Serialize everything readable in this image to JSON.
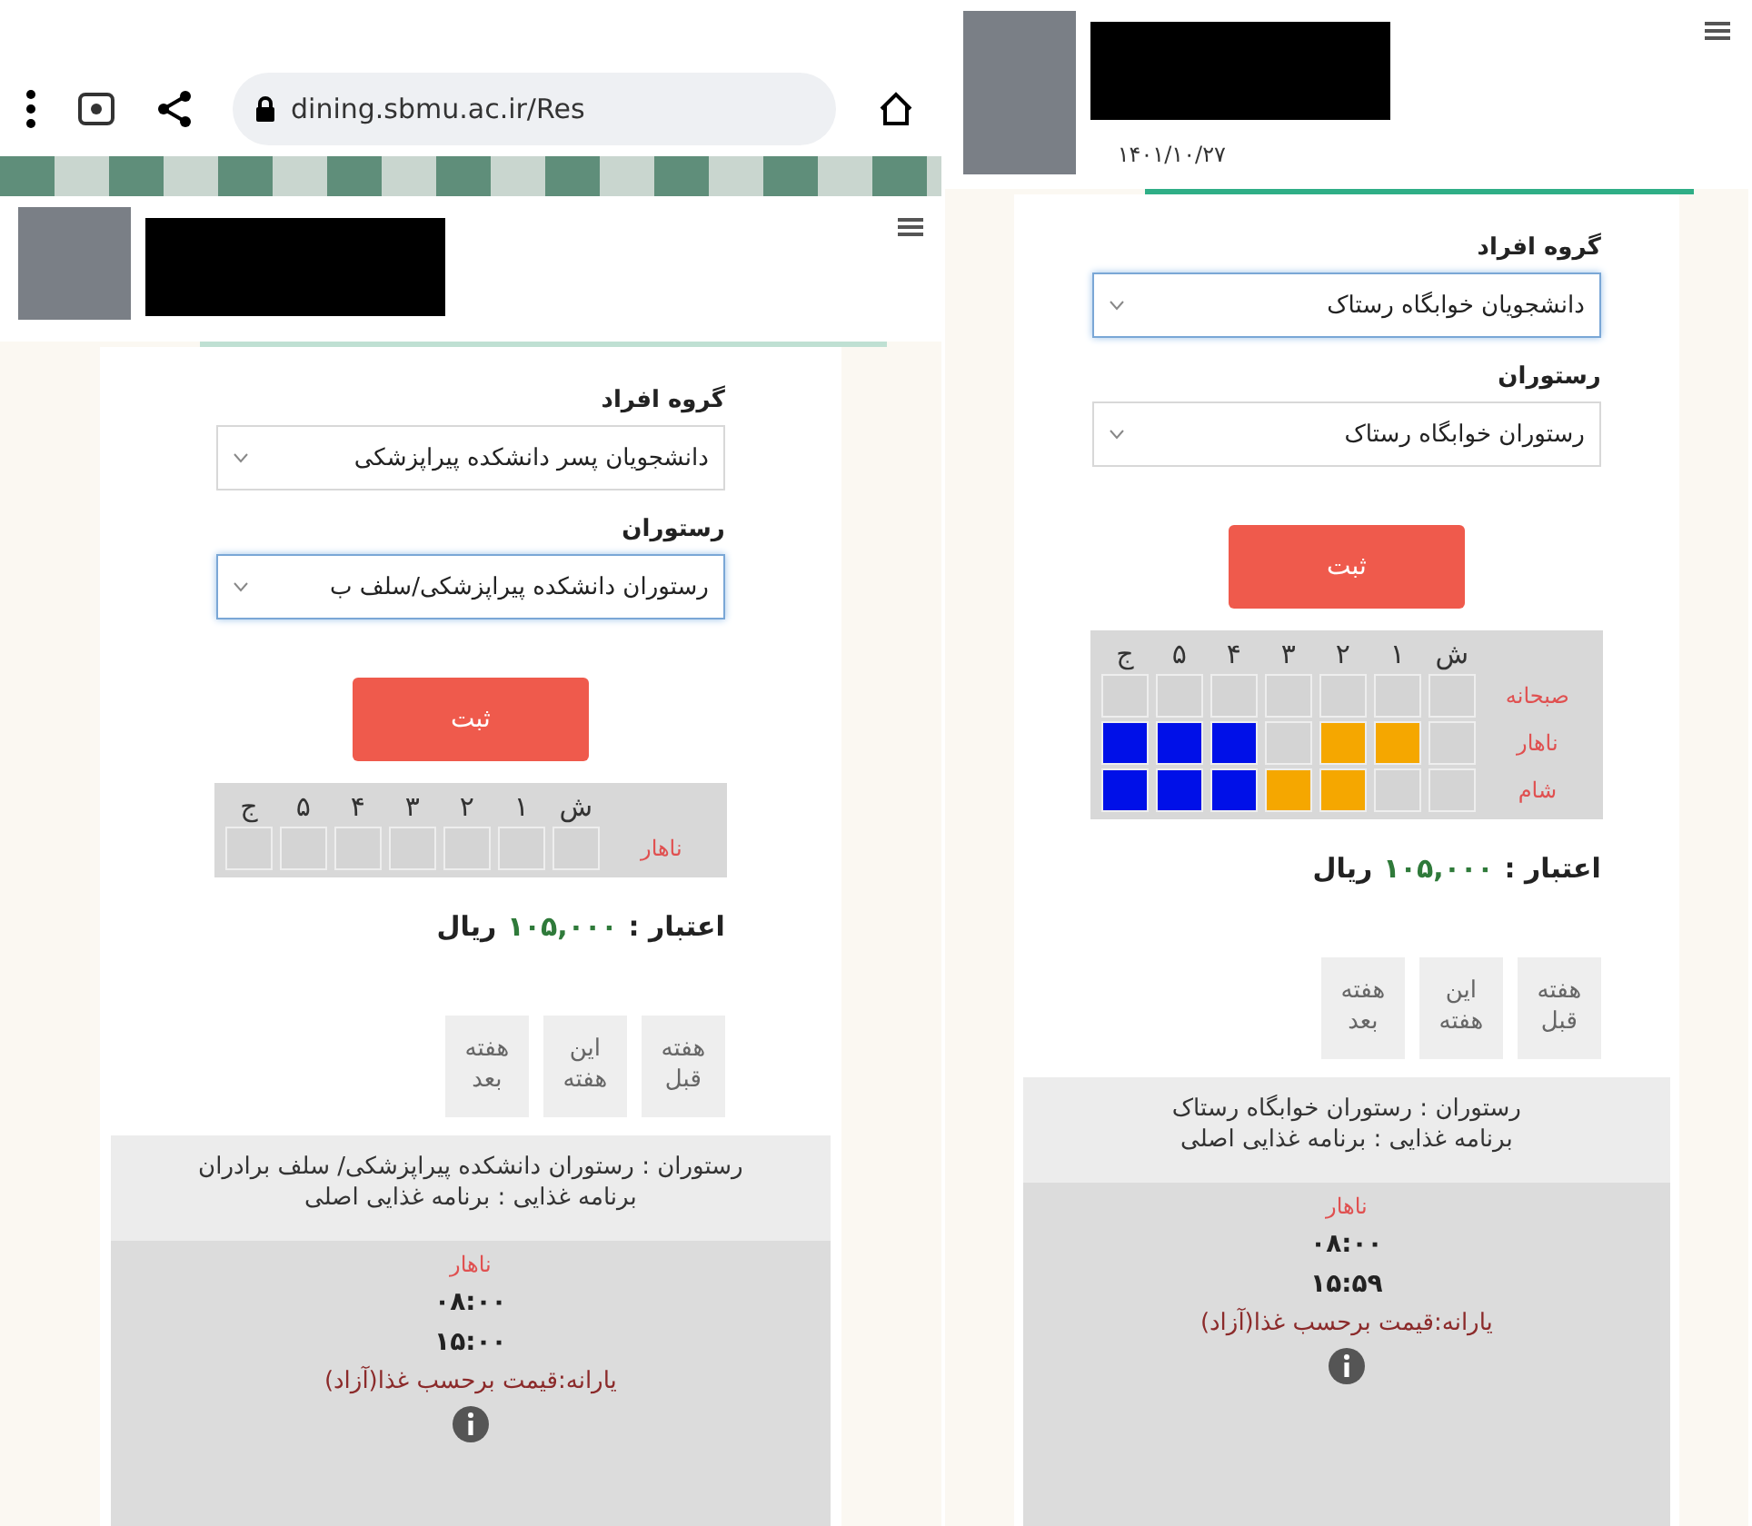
{
  "panels": [
    {
      "header": {
        "redacted": true,
        "date": "۱۴۰۱/۱۰/۲۷"
      },
      "fields": [
        {
          "label": "گروه افراد",
          "value": "دانشجویان خوابگاه رستاک",
          "focused": true
        },
        {
          "label": "رستوران",
          "value": "رستوران خوابگاه رستاک",
          "focused": false
        }
      ],
      "submit": "ثبت",
      "schedule": {
        "days": [
          "ش",
          "۱",
          "۲",
          "۳",
          "۴",
          "۵",
          "ج"
        ],
        "meals": [
          {
            "name": "صبحانه",
            "cells": [
              {
                "filled": false
              },
              {
                "filled": false
              },
              {
                "filled": false
              },
              {
                "filled": false
              },
              {
                "filled": false
              },
              {
                "filled": false
              },
              {
                "filled": false
              }
            ]
          },
          {
            "name": "ناهار",
            "cells": [
              {
                "filled": false
              },
              {
                "filled": true,
                "color": "#f5a700"
              },
              {
                "filled": true,
                "color": "#f5a700"
              },
              {
                "filled": false
              },
              {
                "filled": true,
                "color": "#0010e8"
              },
              {
                "filled": true,
                "color": "#0010e8"
              },
              {
                "filled": true,
                "color": "#0010e8"
              }
            ]
          },
          {
            "name": "شام",
            "cells": [
              {
                "filled": false
              },
              {
                "filled": false
              },
              {
                "filled": true,
                "color": "#f5a700"
              },
              {
                "filled": true,
                "color": "#f5a700"
              },
              {
                "filled": true,
                "color": "#0010e8"
              },
              {
                "filled": true,
                "color": "#0010e8"
              },
              {
                "filled": true,
                "color": "#0010e8"
              }
            ]
          }
        ]
      },
      "credit": {
        "label": "اعتبار :",
        "amount": "۱۰۵,۰۰۰",
        "unit": "ریال"
      },
      "week_buttons": [
        "هفته قبل",
        "این هفته",
        "هفته بعد"
      ],
      "info": {
        "lines": [
          "رستوران : رستوران خوابگاه رستاک",
          "برنامه غذایی : برنامه غذایی اصلی"
        ],
        "meal": "ناهار",
        "start": "۰۸:۰۰",
        "end": "۱۵:۵۹",
        "subsidy": "یارانه:قیمت برحسب غذا(آزاد)"
      }
    },
    {
      "browser": {
        "url": "dining.sbmu.ac.ir/Res"
      },
      "header": {
        "redacted": true
      },
      "fields": [
        {
          "label": "گروه افراد",
          "value": "دانشجویان پسر دانشکده پیراپزشکی",
          "focused": false
        },
        {
          "label": "رستوران",
          "value": "رستوران دانشکده پیراپزشکی/سلف ب",
          "focused": true
        }
      ],
      "submit": "ثبت",
      "schedule": {
        "days": [
          "ش",
          "۱",
          "۲",
          "۳",
          "۴",
          "۵",
          "ج"
        ],
        "meals": [
          {
            "name": "ناهار",
            "cells": [
              {
                "filled": false
              },
              {
                "filled": false
              },
              {
                "filled": false
              },
              {
                "filled": false
              },
              {
                "filled": false
              },
              {
                "filled": false
              },
              {
                "filled": false
              }
            ]
          }
        ]
      },
      "credit": {
        "label": "اعتبار :",
        "amount": "۱۰۵,۰۰۰",
        "unit": "ریال"
      },
      "week_buttons": [
        "هفته قبل",
        "این هفته",
        "هفته بعد"
      ],
      "info": {
        "lines": [
          "رستوران : رستوران دانشکده پیراپزشکی/ سلف برادران",
          "برنامه غذایی : برنامه غذایی اصلی"
        ],
        "meal": "ناهار",
        "start": "۰۸:۰۰",
        "end": "۱۵:۰۰",
        "subsidy": "یارانه:قیمت برحسب غذا(آزاد)"
      }
    }
  ]
}
